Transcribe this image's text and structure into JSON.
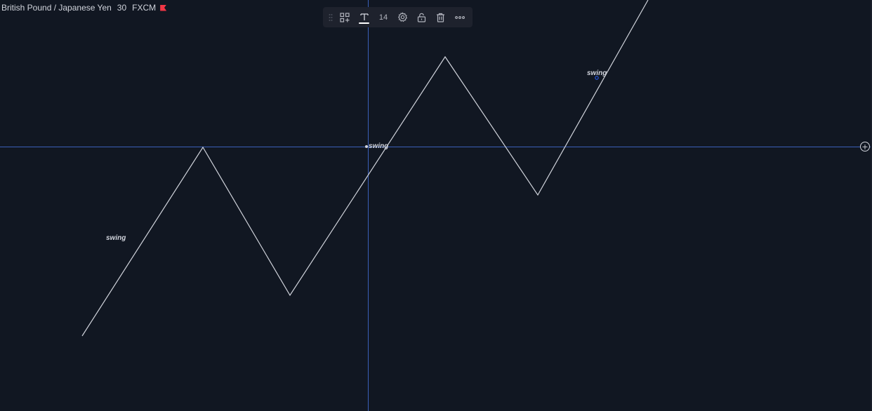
{
  "header": {
    "symbol": "British Pound / Japanese Yen",
    "interval": "30",
    "exchange": "FXCM",
    "flag_color": "#f23645"
  },
  "toolbar": {
    "font_size": "14",
    "icons": [
      "drag-handle-icon",
      "template-icon",
      "text-color-icon",
      "font-size",
      "settings-icon",
      "lock-icon",
      "trash-icon",
      "more-icon"
    ]
  },
  "drawing": {
    "line_color": "#d1d4dc",
    "labels": [
      "swing",
      "swing",
      "swing"
    ]
  },
  "crosshair": {
    "color": "#2962ff",
    "plus_symbol": "+"
  },
  "colors": {
    "background": "#111722",
    "toolbar_bg": "#1e222d",
    "text": "#d1d4dc"
  }
}
